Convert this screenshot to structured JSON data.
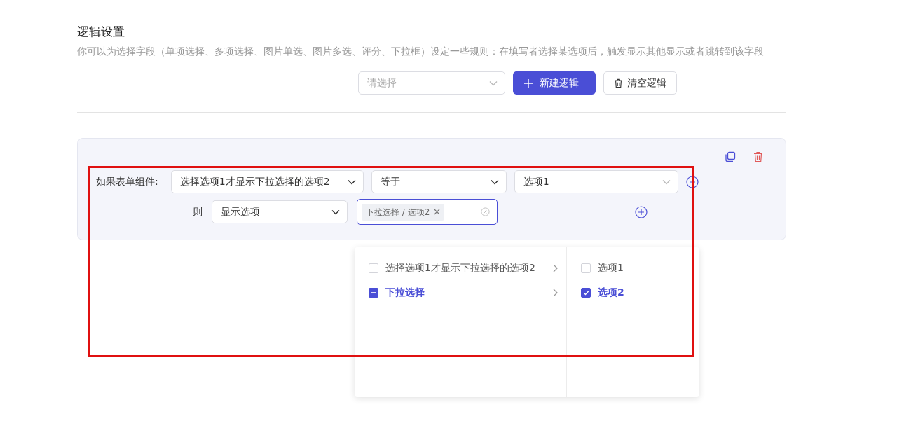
{
  "section": {
    "title": "逻辑设置",
    "description": "你可以为选择字段（单项选择、多项选择、图片单选、图片多选、评分、下拉框）设定一些规则：在填写者选择某选项后，触发显示其他显示或者跳转到该字段"
  },
  "toolbar": {
    "select": {
      "placeholder": "请选择"
    },
    "buttons": [
      {
        "label": "新建逻辑",
        "kind": "primary"
      },
      {
        "label": "清空逻辑",
        "kind": "clear"
      }
    ]
  },
  "rule": {
    "condition_label": "如果表单组件:",
    "field_select": {
      "value": "选择选项1才显示下拉选择的选项2"
    },
    "operator_select": {
      "value": "等于"
    },
    "value_select": {
      "value": "选项1"
    },
    "then_label": "则",
    "action_select": {
      "value": "显示选项"
    },
    "target_tags": [
      "下拉选择 / 选项2"
    ]
  },
  "cascader": {
    "columns": [
      [
        {
          "label": "选择选项1才显示下拉选择的选项2",
          "checked": false,
          "indeterminate": false,
          "expandable": true
        },
        {
          "label": "下拉选择",
          "checked": false,
          "indeterminate": true,
          "expandable": true
        }
      ],
      [
        {
          "label": "选项1",
          "checked": false,
          "expandable": false
        },
        {
          "label": "选项2",
          "checked": true,
          "expandable": false
        }
      ]
    ]
  }
}
